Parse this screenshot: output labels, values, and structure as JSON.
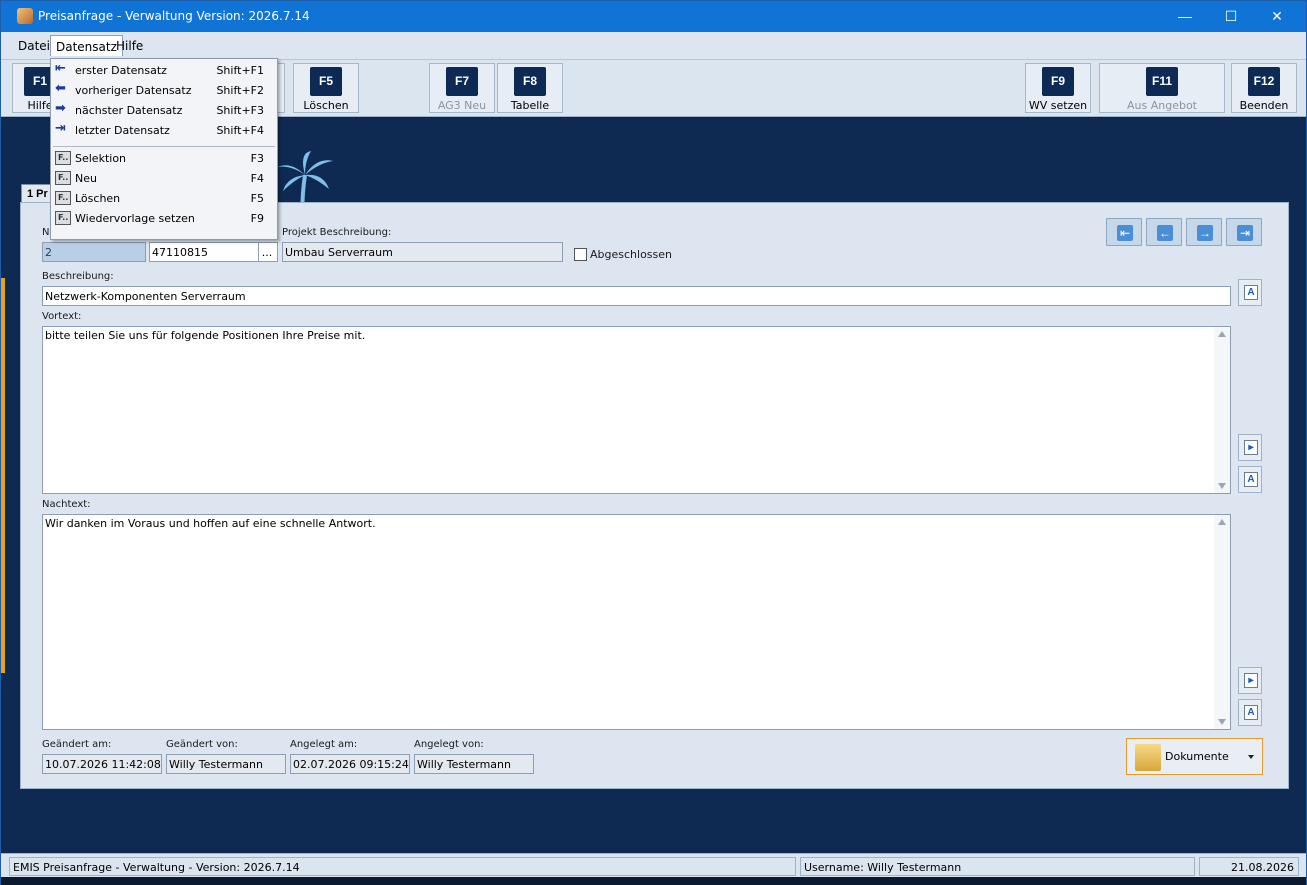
{
  "window": {
    "title": "Preisanfrage - Verwaltung Version: 2026.7.14",
    "minimize": "—",
    "maximize": "☐",
    "close": "✕"
  },
  "menu": {
    "file": "Datei",
    "record": "Datensatz",
    "help": "Hilfe"
  },
  "toolbar": {
    "f1_key": "F1",
    "f1_label": "Hilfe",
    "f5_key": "F5",
    "f5_label": "Löschen",
    "f7_key": "F7",
    "f7_label": "AG3 Neu",
    "f8_key": "F8",
    "f8_label": "Tabelle",
    "f9_key": "F9",
    "f9_label": "WV setzen",
    "f11_key": "F11",
    "f11_label": "Aus Angebot",
    "f12_key": "F12",
    "f12_label": "Beenden"
  },
  "dropdown": {
    "items": [
      {
        "label": "erster Datensatz",
        "shortcut": "Shift+F1",
        "icon": "first-record-arrow-icon"
      },
      {
        "label": "vorheriger Datensatz",
        "shortcut": "Shift+F2",
        "icon": "previous-arrow-icon"
      },
      {
        "label": "nächster Datensatz",
        "shortcut": "Shift+F3",
        "icon": "next-arrow-icon"
      },
      {
        "label": "letzter Datensatz",
        "shortcut": "Shift+F4",
        "icon": "last-record-arrow-icon"
      },
      {
        "label": "Selektion",
        "shortcut": "F3",
        "icon": "function-key-icon"
      },
      {
        "label": "Neu",
        "shortcut": "F4",
        "icon": "function-key-icon"
      },
      {
        "label": "Löschen",
        "shortcut": "F5",
        "icon": "function-key-icon"
      },
      {
        "label": "Wiedervorlage setzen",
        "shortcut": "F9",
        "icon": "function-key-icon"
      }
    ]
  },
  "tab": {
    "label": "1 Pr"
  },
  "form": {
    "nr_label": "N",
    "nr_value": "2",
    "project_value": "47110815",
    "project_browse": "...",
    "project_desc_label": "Projekt Beschreibung:",
    "project_desc_value": "Umbau Serverraum",
    "closed_label": "Abgeschlossen",
    "description_label": "Beschreibung:",
    "description_value": "Netzwerk-Komponenten Serverraum",
    "pretext_label": "Vortext:",
    "pretext_value": "bitte teilen Sie uns für folgende Positionen Ihre Preise mit.",
    "posttext_label": "Nachtext:",
    "posttext_value": "Wir danken im Voraus und hoffen auf eine schnelle Antwort.",
    "changed_on_label": "Geändert am:",
    "changed_on_value": "10.07.2026 11:42:08",
    "changed_by_label": "Geändert von:",
    "changed_by_value": "Willy Testermann",
    "created_on_label": "Angelegt am:",
    "created_on_value": "02.07.2026 09:15:24",
    "created_by_label": "Angelegt von:",
    "created_by_value": "Willy Testermann",
    "documents_label": "Dokumente"
  },
  "nav": {
    "first": "⇤",
    "prev": "←",
    "next": "→",
    "last": "⇥"
  },
  "status": {
    "app": "EMIS Preisanfrage - Verwaltung - Version: 2026.7.14",
    "user": "Username: Willy Testermann",
    "date": "21.08.2026"
  },
  "colors": {
    "titlebar": "#0f74d6",
    "workspace": "#0f2a52",
    "accent_orange": "#e79a2c"
  }
}
